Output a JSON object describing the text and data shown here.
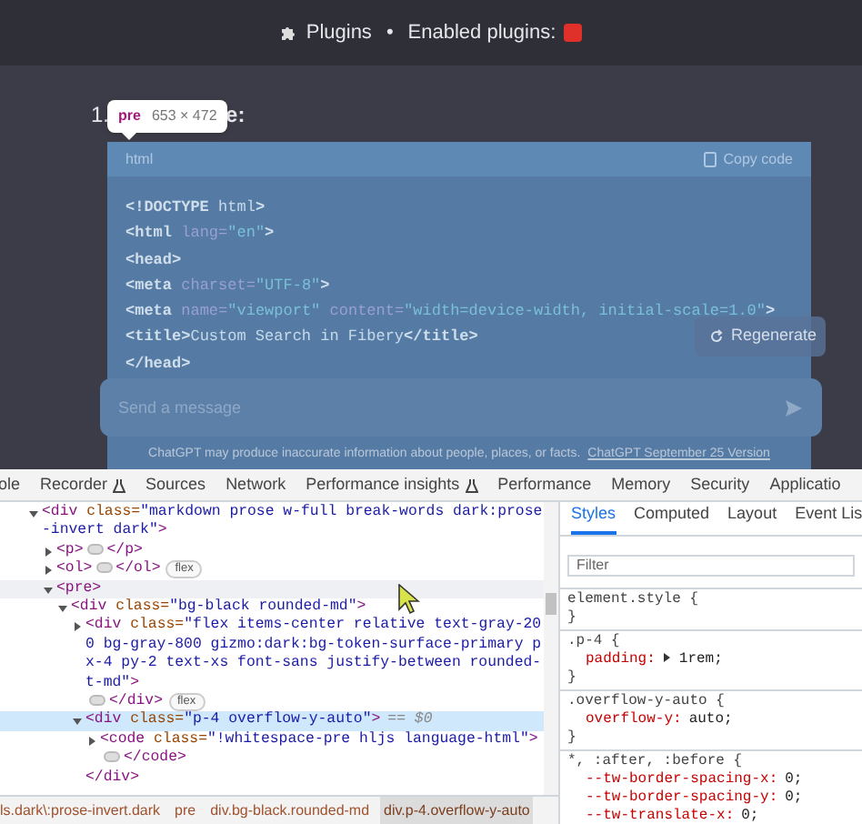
{
  "chat": {
    "header": {
      "plugins_label": "Plugins",
      "separator": "•",
      "enabled_label": "Enabled plugins:"
    },
    "list_item": {
      "number": "1.",
      "visible_text": "e:"
    },
    "inspect_tooltip": {
      "tag": "pre",
      "size": "653 × 472"
    },
    "code_block": {
      "language": "html",
      "copy_label": "Copy code",
      "lines": [
        "<!DOCTYPE html>",
        "<html lang=\"en\">",
        "<head>",
        "<meta charset=\"UTF-8\">",
        "<meta name=\"viewport\" content=\"width=device-width, initial-scale=1.0\">",
        "<title>Custom Search in Fibery</title>",
        "</head>"
      ]
    },
    "regenerate_label": "Regenerate",
    "message_placeholder": "Send a message",
    "footer": {
      "text": "ChatGPT may produce inaccurate information about people, places, or facts.",
      "link": "ChatGPT September 25 Version"
    }
  },
  "devtools": {
    "tabs": [
      {
        "label": "ole",
        "selected": false,
        "beaker": false
      },
      {
        "label": "Recorder",
        "selected": false,
        "beaker": true
      },
      {
        "label": "Sources",
        "selected": false,
        "beaker": false
      },
      {
        "label": "Network",
        "selected": false,
        "beaker": false
      },
      {
        "label": "Performance insights",
        "selected": false,
        "beaker": true
      },
      {
        "label": "Performance",
        "selected": false,
        "beaker": false
      },
      {
        "label": "Memory",
        "selected": false,
        "beaker": false
      },
      {
        "label": "Security",
        "selected": false,
        "beaker": false
      },
      {
        "label": "Applicatio",
        "selected": false,
        "beaker": false
      }
    ],
    "dom_tree": [
      {
        "open": "<div class=\"markdown prose w-full break-words dark:prose-invert dark\">",
        "expanded": true,
        "selected": false,
        "hovered": false,
        "children": [
          {
            "open": "<p>",
            "close": "</p>",
            "expanded": false,
            "selected": false,
            "hovered": false
          },
          {
            "open": "<ol>",
            "close": "</ol>",
            "badge": "flex",
            "expanded": false,
            "selected": false,
            "hovered": false
          },
          {
            "open": "<pre>",
            "expanded": true,
            "selected": false,
            "hovered": true,
            "children": [
              {
                "open": "<div class=\"bg-black rounded-md\">",
                "expanded": true,
                "selected": false,
                "hovered": false,
                "children": [
                  {
                    "open": "<div class=\"flex items-center relative text-gray-200 bg-gray-800 gizmo:dark:bg-token-surface-primary px-4 py-2 text-xs font-sans justify-between rounded-t-md\">",
                    "close": "</div>",
                    "badge": "flex",
                    "expanded": false,
                    "selected": false,
                    "hovered": false
                  },
                  {
                    "open": "<div class=\"p-4 overflow-y-auto\">",
                    "suffix": "== $0",
                    "close_line": "</div>",
                    "expanded": true,
                    "selected": true,
                    "hovered": false,
                    "children": [
                      {
                        "open": "<code class=\"!whitespace-pre hljs language-html\">",
                        "close": "</code>",
                        "expanded": false,
                        "selected": false,
                        "hovered": false
                      }
                    ]
                  }
                ]
              }
            ]
          }
        ]
      }
    ],
    "breadcrumbs": [
      {
        "label": "ls.dark\\:prose-invert.dark",
        "selected": false
      },
      {
        "label": "pre",
        "selected": false
      },
      {
        "label": "div.bg-black.rounded-md",
        "selected": false
      },
      {
        "label": "div.p-4.overflow-y-auto",
        "selected": true
      }
    ],
    "styles_tabs": [
      {
        "label": "Styles",
        "selected": true
      },
      {
        "label": "Computed",
        "selected": false
      },
      {
        "label": "Layout",
        "selected": false
      },
      {
        "label": "Event Lis",
        "selected": false
      }
    ],
    "filter_placeholder": "Filter",
    "rules": [
      {
        "selector": "element.style {",
        "close": "}"
      },
      {
        "selector": ".p-4 {",
        "declarations": [
          {
            "property": "padding:",
            "value": "1rem;",
            "expandable": true
          }
        ],
        "close": "}"
      },
      {
        "selector": ".overflow-y-auto {",
        "declarations": [
          {
            "property": "overflow-y:",
            "value": "auto;",
            "expandable": false
          }
        ],
        "close": "}"
      },
      {
        "selector": "*, :after, :before {",
        "declarations": [
          {
            "property": "--tw-border-spacing-x:",
            "value": "0;",
            "expandable": false
          },
          {
            "property": "--tw-border-spacing-y:",
            "value": "0;",
            "expandable": false
          },
          {
            "property": "--tw-translate-x:",
            "value": "0;",
            "expandable": false
          }
        ]
      }
    ]
  }
}
